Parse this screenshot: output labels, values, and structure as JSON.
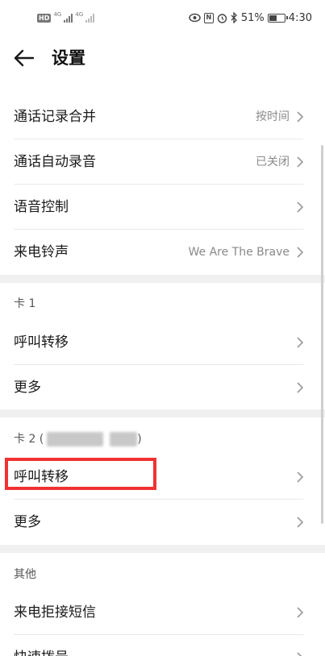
{
  "status_bar": {
    "hd_badge": "HD",
    "hd_sub": "2",
    "network_1": "4G",
    "network_2": "4G",
    "battery": "51%",
    "time": "4:30",
    "battery_level_percent": 51,
    "icons": [
      "eye-icon",
      "nfc-icon",
      "alarm-icon",
      "bluetooth-icon",
      "battery-icon",
      "signal-icon"
    ]
  },
  "header": {
    "title": "设置",
    "back_icon": "back-arrow-icon"
  },
  "general": {
    "items": [
      {
        "label": "通话记录合并",
        "value": "按时间"
      },
      {
        "label": "通话自动录音",
        "value": "已关闭"
      },
      {
        "label": "语音控制",
        "value": ""
      },
      {
        "label": "来电铃声",
        "value": "We Are The Brave"
      }
    ]
  },
  "sim1": {
    "header": "卡 1",
    "items": [
      {
        "label": "呼叫转移"
      },
      {
        "label": "更多"
      }
    ]
  },
  "sim2": {
    "header_prefix": "卡 2 (",
    "header_suffix": ")",
    "items": [
      {
        "label": "呼叫转移"
      },
      {
        "label": "更多"
      }
    ]
  },
  "other": {
    "header": "其他",
    "items": [
      {
        "label": "来电拒接短信"
      },
      {
        "label": "快速拨号"
      }
    ]
  },
  "colors": {
    "highlight": "#f03232",
    "section_gap": "#f0f0f0",
    "value_text": "#8a8a8a"
  }
}
